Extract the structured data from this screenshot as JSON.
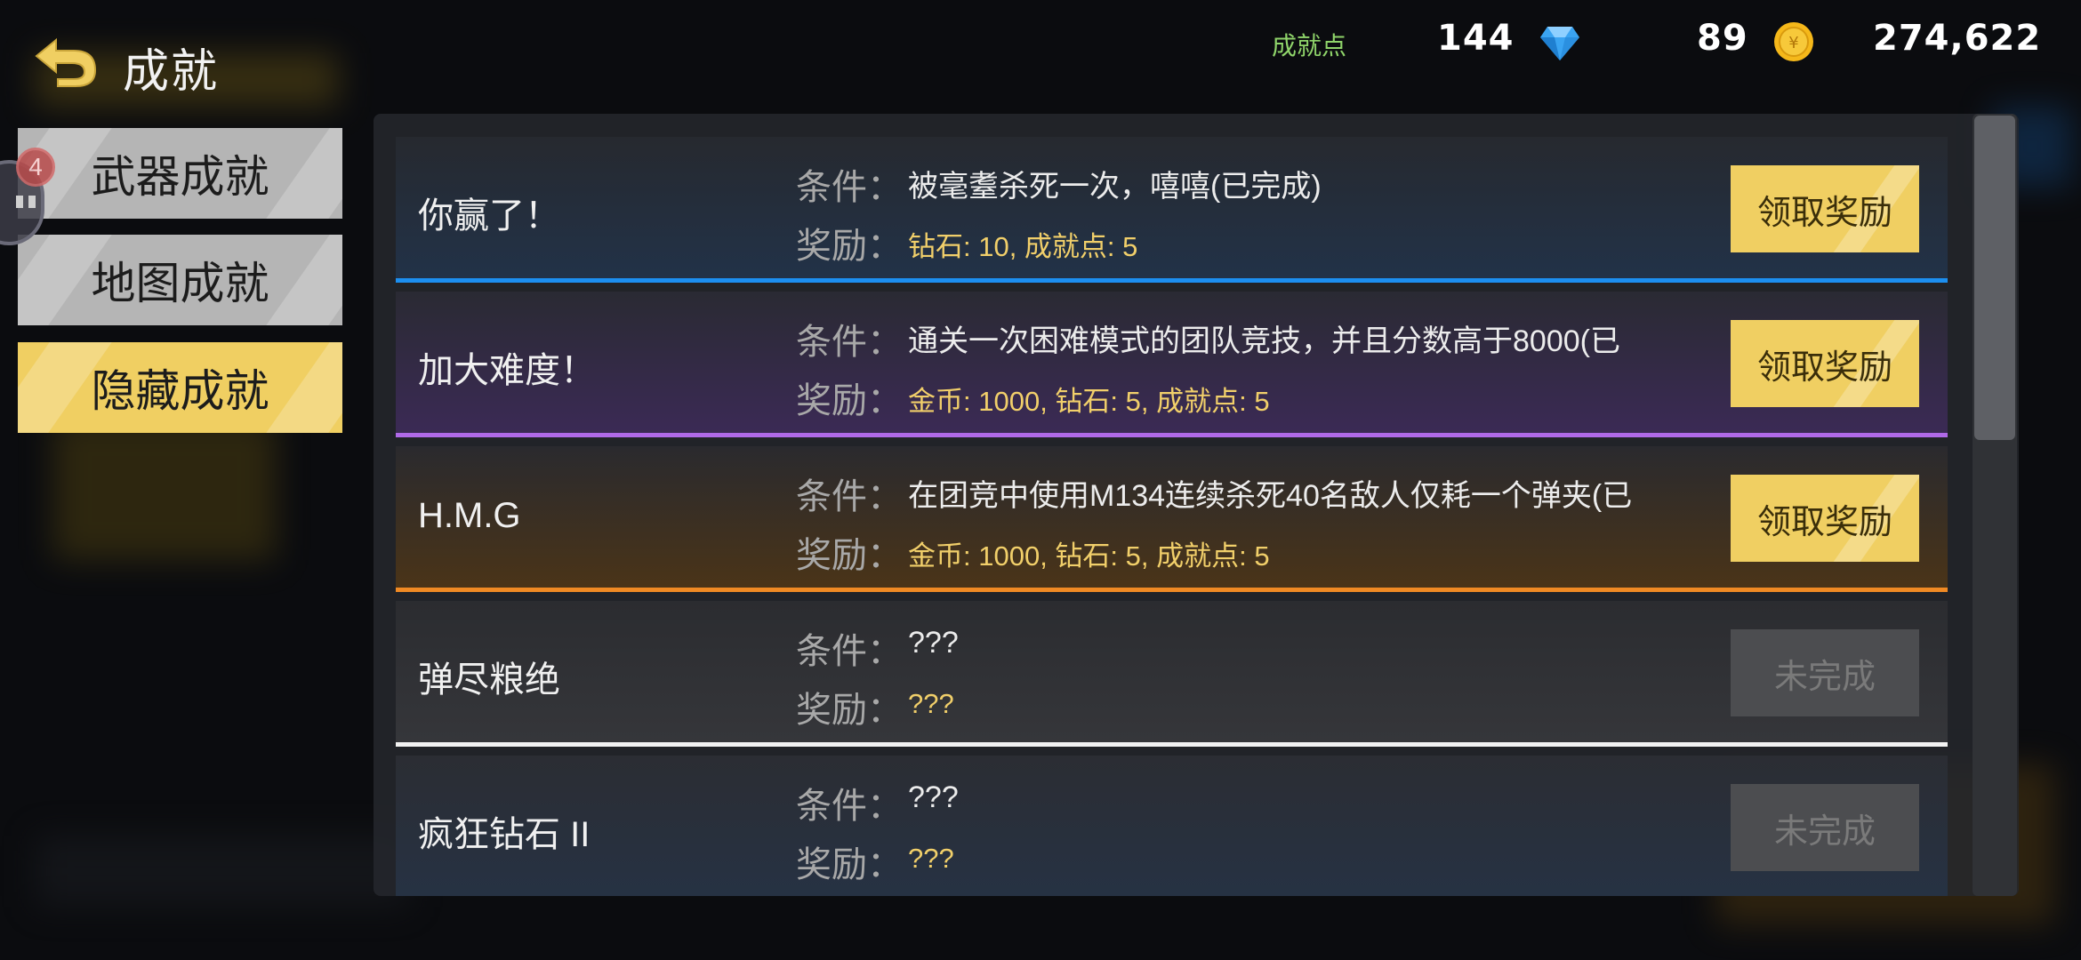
{
  "header": {
    "title": "成就",
    "achievement_points_label": "成就点",
    "achievement_points": "144",
    "diamonds": "89",
    "coins": "274,622"
  },
  "badge": {
    "count": "4"
  },
  "tabs": [
    {
      "label": "武器成就",
      "selected": false
    },
    {
      "label": "地图成就",
      "selected": false
    },
    {
      "label": "隐藏成就",
      "selected": true
    }
  ],
  "labels": {
    "condition": "条件：",
    "reward": "奖励："
  },
  "achievements": [
    {
      "title": "你赢了！",
      "condition": "被毫耋杀死一次，嘻嘻(已完成)",
      "reward": " 钻石: 10,  成就点: 5",
      "button": "领取奖励",
      "accent": "#1c8ff0"
    },
    {
      "title": "加大难度！",
      "condition": "通关一次困难模式的团队竞技，并且分数高于8000(已",
      "reward": "金币: 1000,  钻石: 5,  成就点: 5",
      "button": "领取奖励",
      "accent": "#b069e8"
    },
    {
      "title": "H.M.G",
      "condition": "在团竞中使用M134连续杀死40名敌人仅耗一个弹夹(已",
      "reward": "金币: 1000,  钻石: 5,  成就点: 5",
      "button": "领取奖励",
      "accent": "#f08a24"
    },
    {
      "title": "弹尽粮绝",
      "condition": "???",
      "reward": "???",
      "button": "未完成",
      "accent": "#f2f2f2"
    },
    {
      "title": "疯狂钻石 II",
      "condition": "???",
      "reward": "???",
      "button": "未完成",
      "accent": "#263244"
    }
  ],
  "colors": {
    "gold": "#f0cf62",
    "points_green": "#8fd46a",
    "reward_text": "#f1cf6a"
  },
  "icons": [
    "back-arrow-icon",
    "diamond-icon",
    "coin-icon"
  ]
}
